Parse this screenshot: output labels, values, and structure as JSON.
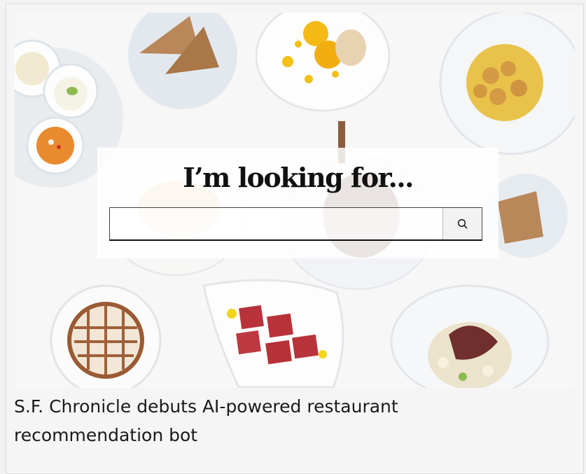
{
  "hero": {
    "image_alt": "overhead view of plated dishes on a white table"
  },
  "search": {
    "title": "I’m looking for...",
    "value": "",
    "placeholder": "",
    "button_icon": "search-icon"
  },
  "caption": {
    "text": "S.F. Chronicle debuts AI-powered restaurant recommendation bot"
  },
  "colors": {
    "page_bg": "#f2f2f2",
    "title": "#111111",
    "caption": "#1a1a1a"
  }
}
